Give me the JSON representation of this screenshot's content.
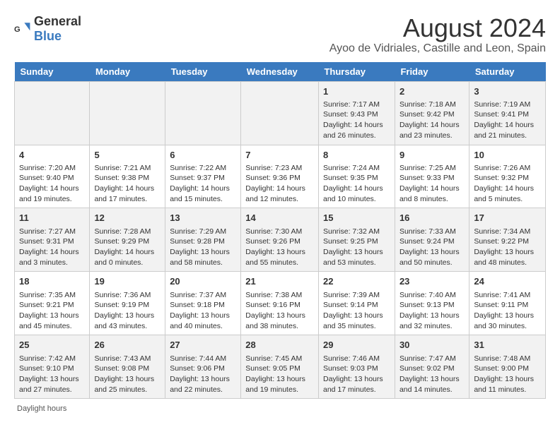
{
  "header": {
    "logo_general": "General",
    "logo_blue": "Blue",
    "main_title": "August 2024",
    "subtitle": "Ayoo de Vidriales, Castille and Leon, Spain"
  },
  "weekdays": [
    "Sunday",
    "Monday",
    "Tuesday",
    "Wednesday",
    "Thursday",
    "Friday",
    "Saturday"
  ],
  "weeks": [
    [
      {
        "day": "",
        "info": ""
      },
      {
        "day": "",
        "info": ""
      },
      {
        "day": "",
        "info": ""
      },
      {
        "day": "",
        "info": ""
      },
      {
        "day": "1",
        "info": "Sunrise: 7:17 AM\nSunset: 9:43 PM\nDaylight: 14 hours and 26 minutes."
      },
      {
        "day": "2",
        "info": "Sunrise: 7:18 AM\nSunset: 9:42 PM\nDaylight: 14 hours and 23 minutes."
      },
      {
        "day": "3",
        "info": "Sunrise: 7:19 AM\nSunset: 9:41 PM\nDaylight: 14 hours and 21 minutes."
      }
    ],
    [
      {
        "day": "4",
        "info": "Sunrise: 7:20 AM\nSunset: 9:40 PM\nDaylight: 14 hours and 19 minutes."
      },
      {
        "day": "5",
        "info": "Sunrise: 7:21 AM\nSunset: 9:38 PM\nDaylight: 14 hours and 17 minutes."
      },
      {
        "day": "6",
        "info": "Sunrise: 7:22 AM\nSunset: 9:37 PM\nDaylight: 14 hours and 15 minutes."
      },
      {
        "day": "7",
        "info": "Sunrise: 7:23 AM\nSunset: 9:36 PM\nDaylight: 14 hours and 12 minutes."
      },
      {
        "day": "8",
        "info": "Sunrise: 7:24 AM\nSunset: 9:35 PM\nDaylight: 14 hours and 10 minutes."
      },
      {
        "day": "9",
        "info": "Sunrise: 7:25 AM\nSunset: 9:33 PM\nDaylight: 14 hours and 8 minutes."
      },
      {
        "day": "10",
        "info": "Sunrise: 7:26 AM\nSunset: 9:32 PM\nDaylight: 14 hours and 5 minutes."
      }
    ],
    [
      {
        "day": "11",
        "info": "Sunrise: 7:27 AM\nSunset: 9:31 PM\nDaylight: 14 hours and 3 minutes."
      },
      {
        "day": "12",
        "info": "Sunrise: 7:28 AM\nSunset: 9:29 PM\nDaylight: 14 hours and 0 minutes."
      },
      {
        "day": "13",
        "info": "Sunrise: 7:29 AM\nSunset: 9:28 PM\nDaylight: 13 hours and 58 minutes."
      },
      {
        "day": "14",
        "info": "Sunrise: 7:30 AM\nSunset: 9:26 PM\nDaylight: 13 hours and 55 minutes."
      },
      {
        "day": "15",
        "info": "Sunrise: 7:32 AM\nSunset: 9:25 PM\nDaylight: 13 hours and 53 minutes."
      },
      {
        "day": "16",
        "info": "Sunrise: 7:33 AM\nSunset: 9:24 PM\nDaylight: 13 hours and 50 minutes."
      },
      {
        "day": "17",
        "info": "Sunrise: 7:34 AM\nSunset: 9:22 PM\nDaylight: 13 hours and 48 minutes."
      }
    ],
    [
      {
        "day": "18",
        "info": "Sunrise: 7:35 AM\nSunset: 9:21 PM\nDaylight: 13 hours and 45 minutes."
      },
      {
        "day": "19",
        "info": "Sunrise: 7:36 AM\nSunset: 9:19 PM\nDaylight: 13 hours and 43 minutes."
      },
      {
        "day": "20",
        "info": "Sunrise: 7:37 AM\nSunset: 9:18 PM\nDaylight: 13 hours and 40 minutes."
      },
      {
        "day": "21",
        "info": "Sunrise: 7:38 AM\nSunset: 9:16 PM\nDaylight: 13 hours and 38 minutes."
      },
      {
        "day": "22",
        "info": "Sunrise: 7:39 AM\nSunset: 9:14 PM\nDaylight: 13 hours and 35 minutes."
      },
      {
        "day": "23",
        "info": "Sunrise: 7:40 AM\nSunset: 9:13 PM\nDaylight: 13 hours and 32 minutes."
      },
      {
        "day": "24",
        "info": "Sunrise: 7:41 AM\nSunset: 9:11 PM\nDaylight: 13 hours and 30 minutes."
      }
    ],
    [
      {
        "day": "25",
        "info": "Sunrise: 7:42 AM\nSunset: 9:10 PM\nDaylight: 13 hours and 27 minutes."
      },
      {
        "day": "26",
        "info": "Sunrise: 7:43 AM\nSunset: 9:08 PM\nDaylight: 13 hours and 25 minutes."
      },
      {
        "day": "27",
        "info": "Sunrise: 7:44 AM\nSunset: 9:06 PM\nDaylight: 13 hours and 22 minutes."
      },
      {
        "day": "28",
        "info": "Sunrise: 7:45 AM\nSunset: 9:05 PM\nDaylight: 13 hours and 19 minutes."
      },
      {
        "day": "29",
        "info": "Sunrise: 7:46 AM\nSunset: 9:03 PM\nDaylight: 13 hours and 17 minutes."
      },
      {
        "day": "30",
        "info": "Sunrise: 7:47 AM\nSunset: 9:02 PM\nDaylight: 13 hours and 14 minutes."
      },
      {
        "day": "31",
        "info": "Sunrise: 7:48 AM\nSunset: 9:00 PM\nDaylight: 13 hours and 11 minutes."
      }
    ]
  ],
  "footer": {
    "daylight_label": "Daylight hours"
  }
}
